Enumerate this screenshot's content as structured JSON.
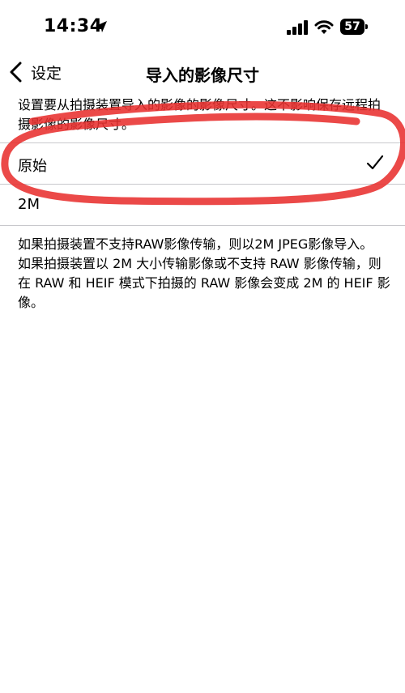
{
  "status": {
    "time": "14:34",
    "battery": "57"
  },
  "nav": {
    "back_label": "设定",
    "title": "导入的影像尺寸"
  },
  "description": "设置要从拍摄装置导入的影像的影像尺寸。这不影响保存远程拍摄影像的影像尺寸。",
  "options": [
    {
      "label": "原始",
      "selected": true
    },
    {
      "label": "2M",
      "selected": false
    }
  ],
  "footnote": {
    "line1": "如果拍摄装置不支持RAW影像传输，则以2M JPEG影像导入。",
    "line2": "如果拍摄装置以 2M 大小传输影像或不支持 RAW 影像传输，则在 RAW 和 HEIF 模式下拍摄的 RAW 影像会变成 2M 的 HEIF 影像。"
  },
  "colors": {
    "annotation_stroke": "#e8302f",
    "separator": "#c8c8cc"
  }
}
